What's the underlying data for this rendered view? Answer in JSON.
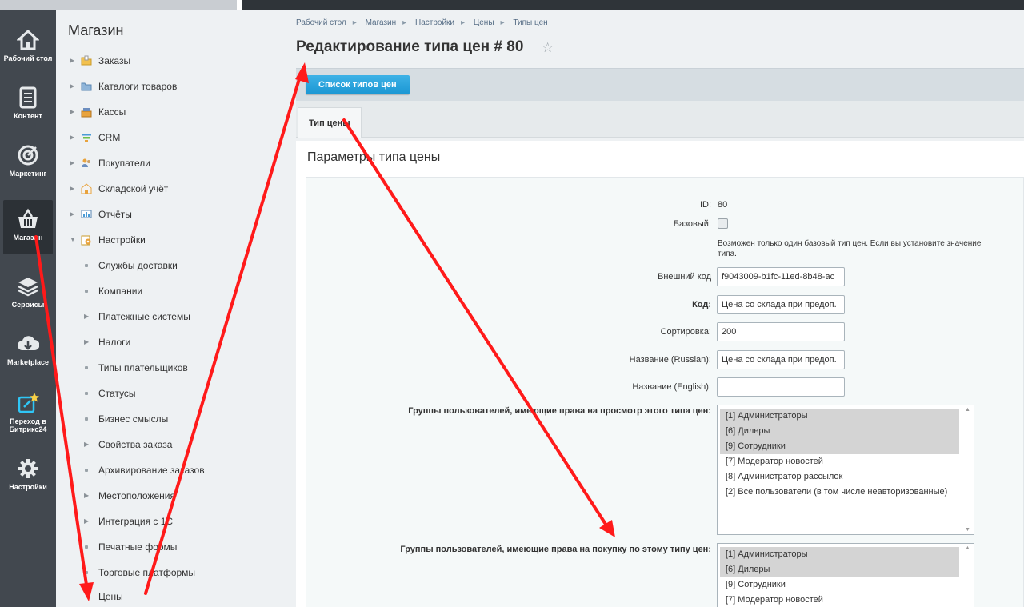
{
  "left_nav": [
    {
      "label": "Рабочий стол",
      "icon": "home-icon"
    },
    {
      "label": "Контент",
      "icon": "document-icon"
    },
    {
      "label": "Маркетинг",
      "icon": "target-icon"
    },
    {
      "label": "Магазин",
      "icon": "basket-icon"
    },
    {
      "label": "Сервисы",
      "icon": "layers-icon"
    },
    {
      "label": "Marketplace",
      "icon": "cloud-download-icon"
    },
    {
      "label": "Переход в Битрикс24",
      "icon": "external-star-icon"
    },
    {
      "label": "Настройки",
      "icon": "gear-icon"
    }
  ],
  "menu": {
    "title": "Магазин",
    "items": [
      {
        "label": "Заказы",
        "icon": "folder-icon",
        "arrow": "▶"
      },
      {
        "label": "Каталоги товаров",
        "icon": "folder-icon",
        "arrow": "▶"
      },
      {
        "label": "Кассы",
        "icon": "cash-register-icon",
        "arrow": "▶"
      },
      {
        "label": "CRM",
        "icon": "funnel-icon",
        "arrow": "▶"
      },
      {
        "label": "Покупатели",
        "icon": "users-icon",
        "arrow": "▶"
      },
      {
        "label": "Складской учёт",
        "icon": "warehouse-icon",
        "arrow": "▶"
      },
      {
        "label": "Отчёты",
        "icon": "report-icon",
        "arrow": "▶"
      },
      {
        "label": "Настройки",
        "icon": "settings-folder-icon",
        "arrow": "▼"
      }
    ],
    "subitems": [
      {
        "label": "Службы доставки",
        "kind": "dot"
      },
      {
        "label": "Компании",
        "kind": "dot"
      },
      {
        "label": "Платежные системы",
        "kind": "arrow"
      },
      {
        "label": "Налоги",
        "kind": "arrow"
      },
      {
        "label": "Типы плательщиков",
        "kind": "dot"
      },
      {
        "label": "Статусы",
        "kind": "dot"
      },
      {
        "label": "Бизнес смыслы",
        "kind": "dot"
      },
      {
        "label": "Свойства заказа",
        "kind": "arrow"
      },
      {
        "label": "Архивирование заказов",
        "kind": "dot"
      },
      {
        "label": "Местоположения",
        "kind": "arrow"
      },
      {
        "label": "Интеграция с 1С",
        "kind": "arrow"
      },
      {
        "label": "Печатные формы",
        "kind": "dot"
      },
      {
        "label": "Торговые платформы",
        "kind": "dot"
      },
      {
        "label": "Цены",
        "kind": "open"
      }
    ]
  },
  "breadcrumb": [
    "Рабочий стол",
    "Магазин",
    "Настройки",
    "Цены",
    "Типы цен"
  ],
  "page_title": "Редактирование типа цен # 80",
  "toolbar": {
    "list_button": "Список типов цен"
  },
  "tab": "Тип цены",
  "section_title": "Параметры типа цены",
  "form": {
    "id_label": "ID:",
    "id_value": "80",
    "base_label": "Базовый:",
    "base_checked": false,
    "base_note_1": "Возможен только один базовый тип цен. Если вы установите значение",
    "base_note_2": "типа.",
    "ext_code_label": "Внешний код",
    "ext_code_value": "f9043009-b1fc-11ed-8b48-ac",
    "code_label": "Код:",
    "code_value": "Цена со склада при предоп.",
    "sort_label": "Сортировка:",
    "sort_value": "200",
    "name_ru_label": "Название (Russian):",
    "name_ru_value": "Цена со склада при предоп.",
    "name_en_label": "Название (English):",
    "name_en_value": "",
    "view_groups_label": "Группы пользователей, имеющие права на просмотр этого типа цен:",
    "view_groups": [
      {
        "label": "[1] Администраторы",
        "selected": true
      },
      {
        "label": "[6] Дилеры",
        "selected": true
      },
      {
        "label": "[9] Сотрудники",
        "selected": true
      },
      {
        "label": "[7] Модератор новостей",
        "selected": false
      },
      {
        "label": "[8] Администратор рассылок",
        "selected": false
      },
      {
        "label": "[2] Все пользователи (в том числе неавторизованные)",
        "selected": false
      }
    ],
    "buy_groups_label": "Группы пользователей, имеющие права на покупку по этому типу цен:",
    "buy_groups": [
      {
        "label": "[1] Администраторы",
        "selected": true
      },
      {
        "label": "[6] Дилеры",
        "selected": true
      },
      {
        "label": "[9] Сотрудники",
        "selected": false
      },
      {
        "label": "[7] Модератор новостей",
        "selected": false
      }
    ]
  },
  "colors": {
    "annotation_arrow": "#ff1a1a",
    "button_blue": "#1a96d3",
    "nav_dark": "#42484f"
  }
}
